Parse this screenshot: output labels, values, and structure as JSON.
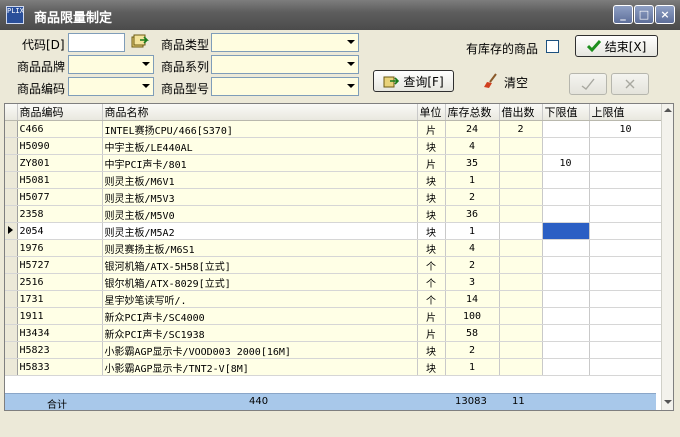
{
  "window": {
    "icon_text": "PLIX",
    "title": "商品限量制定",
    "min_label": "_",
    "max_label": "□",
    "close_label": "×"
  },
  "filters": {
    "code_label": "代码[D]",
    "code_value": "",
    "type_label": "商品类型",
    "type_value": "",
    "brand_label": "商品品牌",
    "brand_value": "",
    "series_label": "商品系列",
    "series_value": "",
    "itemcode_label": "商品编码",
    "itemcode_value": "",
    "model_label": "商品型号",
    "model_value": ""
  },
  "actions": {
    "instock_label": "有库存的商品",
    "instock_checked": false,
    "finish_label": "结束[X]",
    "query_label": "查询[F]",
    "clear_label": "清空"
  },
  "grid": {
    "headers": [
      "商品编码",
      "商品名称",
      "单位",
      "库存总数",
      "借出数",
      "下限值",
      "上限值"
    ],
    "rows": [
      [
        "C466",
        "INTEL赛扬CPU/466[S370]",
        "片",
        "24",
        "2",
        "",
        "10"
      ],
      [
        "H5090",
        "中宇主板/LE440AL",
        "块",
        "4",
        "",
        "",
        ""
      ],
      [
        "ZY801",
        "中宇PCI声卡/801",
        "片",
        "35",
        "",
        "10",
        ""
      ],
      [
        "H5081",
        "则灵主板/M6V1",
        "块",
        "1",
        "",
        "",
        ""
      ],
      [
        "H5077",
        "则灵主板/M5V3",
        "块",
        "2",
        "",
        "",
        ""
      ],
      [
        "2358",
        "则灵主板/M5V0",
        "块",
        "36",
        "",
        "",
        ""
      ],
      [
        "2054",
        "则灵主板/M5A2",
        "块",
        "1",
        "",
        "",
        ""
      ],
      [
        "1976",
        "则灵赛扬主板/M6S1",
        "块",
        "4",
        "",
        "",
        ""
      ],
      [
        "H5727",
        "银河机箱/ATX-5H58[立式]",
        "个",
        "2",
        "",
        "",
        ""
      ],
      [
        "2516",
        "银尔机箱/ATX-8029[立式]",
        "个",
        "3",
        "",
        "",
        ""
      ],
      [
        "1731",
        "星宇妙笔读写听/.",
        "个",
        "14",
        "",
        "",
        ""
      ],
      [
        "1911",
        "新众PCI声卡/SC4000",
        "片",
        "100",
        "",
        "",
        ""
      ],
      [
        "H3434",
        "新众PCI声卡/SC1938",
        "片",
        "58",
        "",
        "",
        ""
      ],
      [
        "H5823",
        "小影霸AGP显示卡/VOOD003 2000[16M]",
        "块",
        "2",
        "",
        "",
        ""
      ],
      [
        "H5833",
        "小影霸AGP显示卡/TNT2-V[8M]",
        "块",
        "1",
        "",
        "",
        ""
      ]
    ],
    "current_row_index": 6
  },
  "totals": {
    "label": "合计",
    "count": "440",
    "stock_total": "13083",
    "lent_total": "11"
  }
}
